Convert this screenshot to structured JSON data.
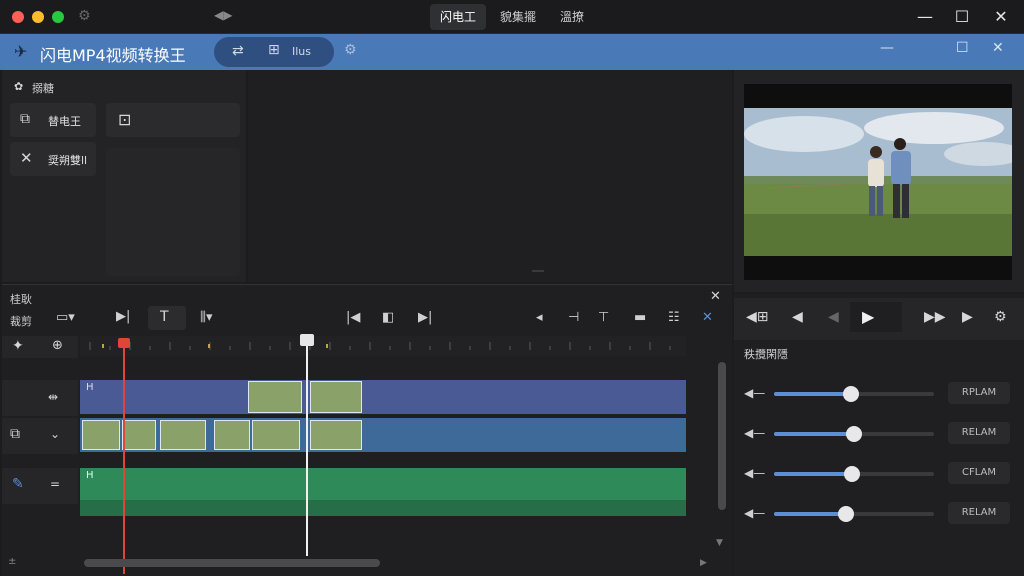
{
  "os_bar": {
    "tabs": [
      {
        "label": "闪电工",
        "active": true
      },
      {
        "label": "貌集擺",
        "active": false
      },
      {
        "label": "溫撩",
        "active": false
      }
    ]
  },
  "app_bar": {
    "title": "闪电MP4视频转换王",
    "pill_label": "Ilus"
  },
  "left_panel": {
    "header": "搦糖",
    "buttons": [
      {
        "label": "替电王"
      },
      {
        "label": "奨朔雙ll"
      }
    ]
  },
  "timeline": {
    "panel_label": "桂耿",
    "toolbar_label": "裁剪"
  },
  "right_panel": {
    "section_title": "秩攬閑隱",
    "sliders": [
      {
        "value": 0.48,
        "label": "RPLAM"
      },
      {
        "value": 0.5,
        "label": "RELAM"
      },
      {
        "value": 0.49,
        "label": "CFLAM"
      },
      {
        "value": 0.45,
        "label": "RELAM"
      }
    ]
  },
  "colors": {
    "accent": "#4a79b8",
    "playhead": "#e0453a",
    "video_track": "#4a5a94",
    "audio_track": "#2f8a5a"
  }
}
